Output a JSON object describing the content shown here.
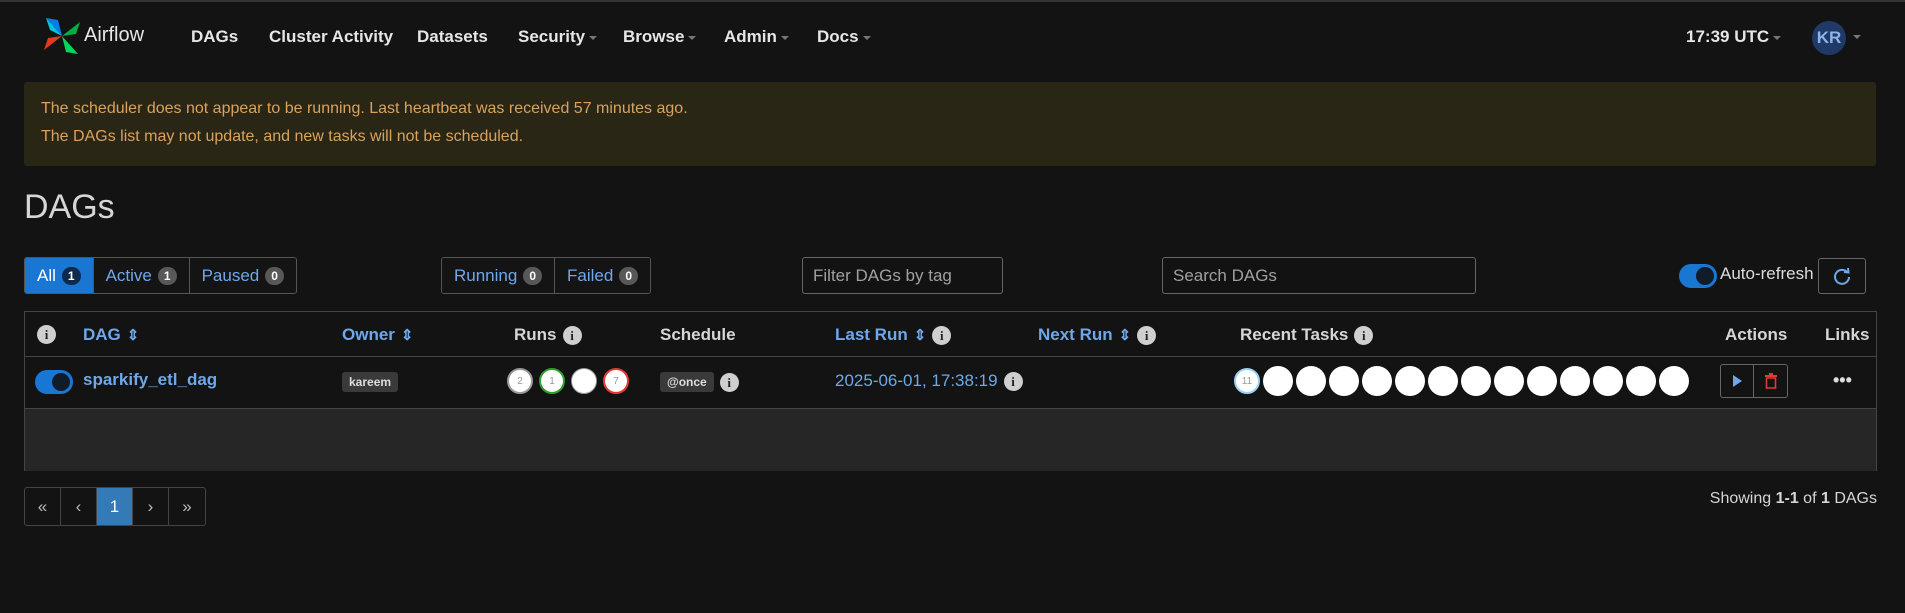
{
  "nav": {
    "brand": "Airflow",
    "items": [
      "DAGs",
      "Cluster Activity",
      "Datasets",
      "Security",
      "Browse",
      "Admin",
      "Docs"
    ],
    "time": "17:39 UTC",
    "user_initials": "KR"
  },
  "alert": {
    "line1": "The scheduler does not appear to be running. Last heartbeat was received 57 minutes ago.",
    "line2": "The DAGs list may not update, and new tasks will not be scheduled."
  },
  "page_title": "DAGs",
  "filters": {
    "all": {
      "label": "All",
      "count": "1"
    },
    "active": {
      "label": "Active",
      "count": "1"
    },
    "paused": {
      "label": "Paused",
      "count": "0"
    },
    "running": {
      "label": "Running",
      "count": "0"
    },
    "failed": {
      "label": "Failed",
      "count": "0"
    },
    "tag_placeholder": "Filter DAGs by tag",
    "search_placeholder": "Search DAGs",
    "auto_refresh_label": "Auto-refresh"
  },
  "table": {
    "headers": {
      "dag": "DAG",
      "owner": "Owner",
      "runs": "Runs",
      "schedule": "Schedule",
      "last_run": "Last Run",
      "next_run": "Next Run",
      "recent_tasks": "Recent Tasks",
      "actions": "Actions",
      "links": "Links"
    },
    "rows": [
      {
        "dag_id": "sparkify_etl_dag",
        "owner": "kareem",
        "runs": [
          "2",
          "1",
          "",
          "7"
        ],
        "schedule": "@once",
        "last_run": "2025-06-01, 17:38:19",
        "next_run": "",
        "recent_tasks_first": "11",
        "recent_tasks_count": 14
      }
    ]
  },
  "pagination": {
    "first": "«",
    "prev": "‹",
    "current": "1",
    "next": "›",
    "last": "»"
  },
  "footer": {
    "showing_prefix": "Showing ",
    "range": "1-1",
    "of": " of ",
    "total": "1",
    "suffix": " DAGs"
  },
  "colors": {
    "accent": "#1976d2",
    "run_success": "#2e9e2e",
    "run_failed": "#e53935",
    "link": "#6ea8ea",
    "alert_text": "#d9a25d"
  },
  "icons": [
    "airflow-logo-icon",
    "info-icon",
    "sort-icon",
    "play-icon",
    "trash-icon",
    "refresh-icon",
    "more-icon"
  ]
}
